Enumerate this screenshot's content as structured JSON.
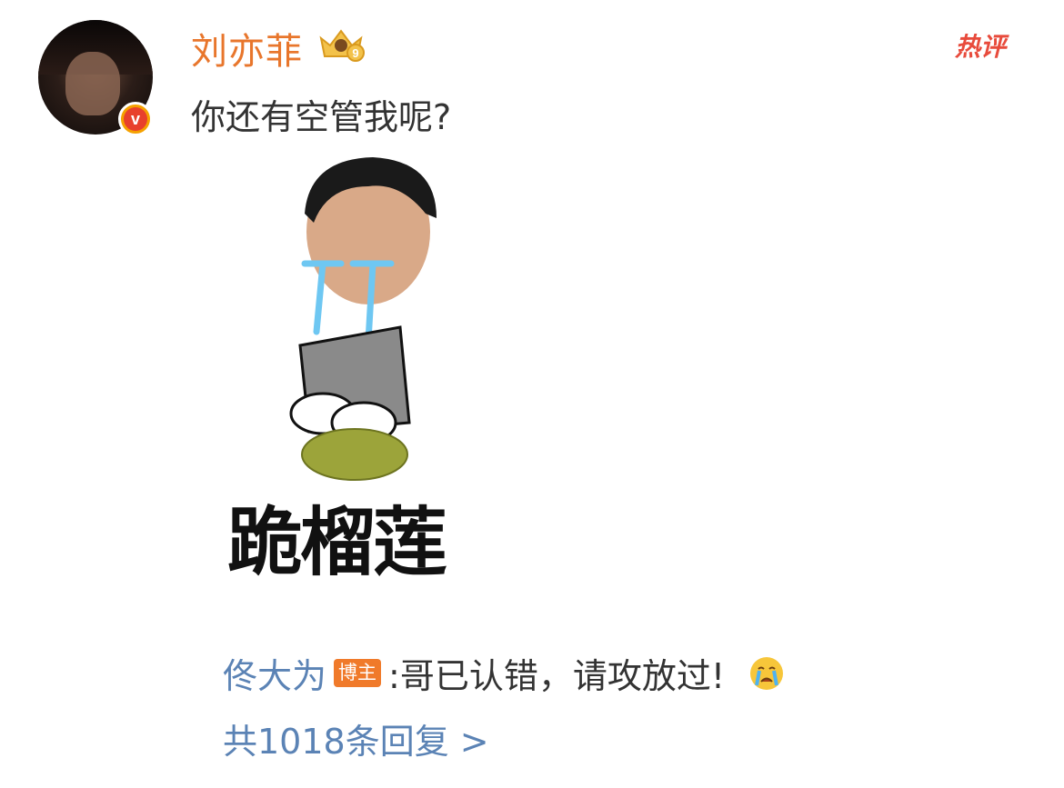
{
  "comment": {
    "username": "刘亦菲",
    "badge_level": "9",
    "text": "你还有空管我呢?",
    "hot_label": "热评",
    "sticker_caption": "跪榴莲"
  },
  "reply": {
    "author": "佟大为",
    "author_tag": "博主",
    "text": ":哥已认错，请攻放过!"
  },
  "more_replies": "共1018条回复 >",
  "colors": {
    "username": "#e8762c",
    "link_blue": "#5b83b5",
    "hot_red": "#e84b3c",
    "tag_orange": "#f07a2a"
  }
}
